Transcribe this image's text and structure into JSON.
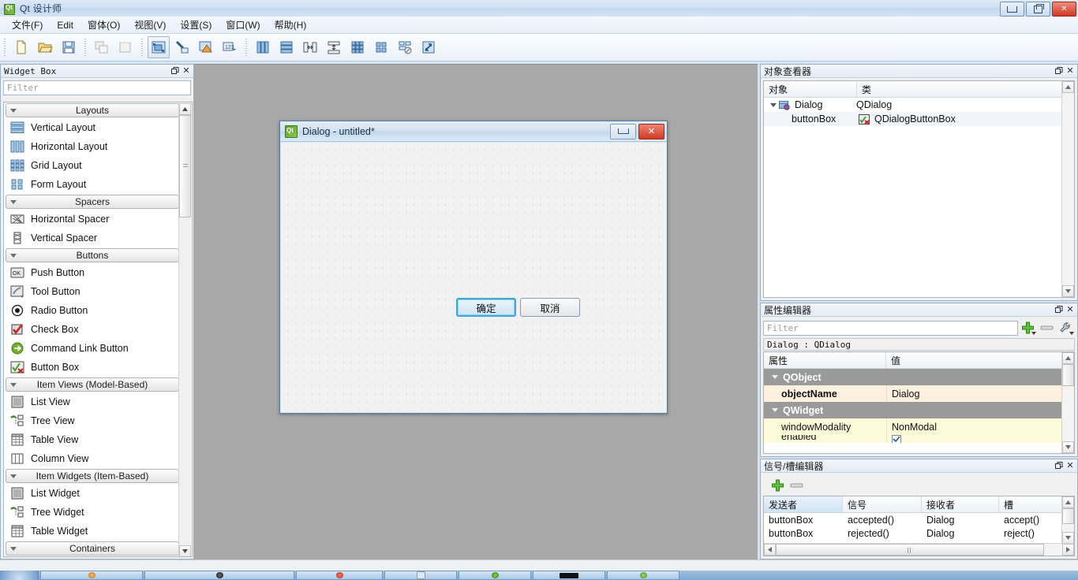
{
  "window": {
    "title": "Qt 设计师",
    "app_icon": "qt-logo-icon",
    "buttons": {
      "minimize": "minimize-icon",
      "maximize": "maximize-icon",
      "close": "close-icon"
    }
  },
  "menubar": {
    "items": [
      {
        "label": "文件(F)",
        "name": "menu-file"
      },
      {
        "label": "Edit",
        "name": "menu-edit"
      },
      {
        "label": "窗体(O)",
        "name": "menu-form"
      },
      {
        "label": "视图(V)",
        "name": "menu-view"
      },
      {
        "label": "设置(S)",
        "name": "menu-settings"
      },
      {
        "label": "窗口(W)",
        "name": "menu-window"
      },
      {
        "label": "帮助(H)",
        "name": "menu-help"
      }
    ]
  },
  "toolbar": {
    "groups": [
      {
        "buttons": [
          {
            "name": "new-form-button",
            "icon": "new-document-icon"
          },
          {
            "name": "open-form-button",
            "icon": "open-folder-icon"
          },
          {
            "name": "save-form-button",
            "icon": "save-disk-icon"
          }
        ]
      },
      {
        "buttons": [
          {
            "name": "undo-button",
            "icon": "undo-icon"
          },
          {
            "name": "redo-button",
            "icon": "redo-icon"
          }
        ]
      },
      {
        "buttons": [
          {
            "name": "edit-widgets-button",
            "icon": "edit-widgets-icon",
            "active": true
          },
          {
            "name": "edit-signals-slots-button",
            "icon": "signals-slots-icon"
          },
          {
            "name": "edit-buddies-button",
            "icon": "buddies-icon"
          },
          {
            "name": "edit-tab-order-button",
            "icon": "tab-order-icon"
          }
        ]
      },
      {
        "buttons": [
          {
            "name": "layout-horizontally-button",
            "icon": "layout-horizontal-icon"
          },
          {
            "name": "layout-vertically-button",
            "icon": "layout-vertical-icon"
          },
          {
            "name": "layout-in-splitter-horizontal-button",
            "icon": "splitter-horizontal-icon"
          },
          {
            "name": "layout-in-splitter-vertical-button",
            "icon": "splitter-vertical-icon"
          },
          {
            "name": "layout-in-grid-button",
            "icon": "layout-grid-icon"
          },
          {
            "name": "layout-in-form-button",
            "icon": "layout-form-icon"
          },
          {
            "name": "break-layout-button",
            "icon": "break-layout-icon"
          },
          {
            "name": "adjust-size-button",
            "icon": "adjust-size-icon"
          }
        ]
      }
    ]
  },
  "widget_box": {
    "title": "Widget Box",
    "filter_placeholder": "Filter",
    "titlebar_buttons": {
      "float": "float-icon",
      "close": "close-icon"
    },
    "categories": [
      {
        "name": "Layouts",
        "items": [
          {
            "label": "Vertical Layout",
            "icon": "vertical-layout-icon"
          },
          {
            "label": "Horizontal Layout",
            "icon": "horizontal-layout-icon"
          },
          {
            "label": "Grid Layout",
            "icon": "grid-layout-icon"
          },
          {
            "label": "Form Layout",
            "icon": "form-layout-icon"
          }
        ]
      },
      {
        "name": "Spacers",
        "items": [
          {
            "label": "Horizontal Spacer",
            "icon": "horizontal-spacer-icon"
          },
          {
            "label": "Vertical Spacer",
            "icon": "vertical-spacer-icon"
          }
        ]
      },
      {
        "name": "Buttons",
        "items": [
          {
            "label": "Push Button",
            "icon": "push-button-icon"
          },
          {
            "label": "Tool Button",
            "icon": "tool-button-icon"
          },
          {
            "label": "Radio Button",
            "icon": "radio-button-icon"
          },
          {
            "label": "Check Box",
            "icon": "check-box-icon"
          },
          {
            "label": "Command Link Button",
            "icon": "command-link-icon"
          },
          {
            "label": "Button Box",
            "icon": "button-box-icon"
          }
        ]
      },
      {
        "name": "Item Views (Model-Based)",
        "items": [
          {
            "label": "List View",
            "icon": "list-view-icon"
          },
          {
            "label": "Tree View",
            "icon": "tree-view-icon"
          },
          {
            "label": "Table View",
            "icon": "table-view-icon"
          },
          {
            "label": "Column View",
            "icon": "column-view-icon"
          }
        ]
      },
      {
        "name": "Item Widgets (Item-Based)",
        "items": [
          {
            "label": "List Widget",
            "icon": "list-widget-icon"
          },
          {
            "label": "Tree Widget",
            "icon": "tree-widget-icon"
          },
          {
            "label": "Table Widget",
            "icon": "table-widget-icon"
          }
        ]
      },
      {
        "name": "Containers",
        "items": []
      }
    ]
  },
  "form_window": {
    "title": "Dialog - untitled*",
    "icon": "qt-form-icon",
    "buttons": {
      "minimize": "minimize-icon",
      "close": "close-icon"
    },
    "widgets": [
      {
        "label": "确定",
        "name": "ok-button",
        "selected": true
      },
      {
        "label": "取消",
        "name": "cancel-button",
        "selected": false
      }
    ]
  },
  "object_inspector": {
    "title": "对象查看器",
    "titlebar_buttons": {
      "float": "float-icon",
      "close": "close-icon"
    },
    "columns": [
      "对象",
      "类"
    ],
    "rows": [
      {
        "object": "Dialog",
        "class": "QDialog",
        "indent": 0,
        "expandable": true,
        "icon": "qdialog-icon"
      },
      {
        "object": "buttonBox",
        "class": "QDialogButtonBox",
        "indent": 1,
        "expandable": false,
        "icon": "button-box-icon"
      }
    ]
  },
  "property_editor": {
    "title": "属性编辑器",
    "titlebar_buttons": {
      "float": "float-icon",
      "close": "close-icon"
    },
    "filter_placeholder": "Filter",
    "tools": [
      {
        "name": "add-dynamic-property-button",
        "icon": "plus-icon"
      },
      {
        "name": "remove-dynamic-property-button",
        "icon": "minus-icon"
      },
      {
        "name": "configure-property-editor-button",
        "icon": "wrench-icon"
      }
    ],
    "object_line": "Dialog : QDialog",
    "columns": [
      "属性",
      "值"
    ],
    "rows": [
      {
        "type": "group",
        "key": "QObject"
      },
      {
        "type": "prop",
        "key": "objectName",
        "value": "Dialog",
        "modified": true,
        "bg": "#fdf0df"
      },
      {
        "type": "group",
        "key": "QWidget"
      },
      {
        "type": "prop",
        "key": "windowModality",
        "value": "NonModal",
        "modified": false,
        "bg": "#fdfbd9"
      },
      {
        "type": "prop",
        "key": "enabled",
        "value": "",
        "modified": false,
        "bg": "#fdfbd9"
      }
    ]
  },
  "signal_slot_editor": {
    "title": "信号/槽编辑器",
    "titlebar_buttons": {
      "float": "float-icon",
      "close": "close-icon"
    },
    "tools": [
      {
        "name": "add-connection-button",
        "icon": "plus-icon"
      },
      {
        "name": "remove-connection-button",
        "icon": "minus-icon"
      }
    ],
    "columns": [
      "发送者",
      "信号",
      "接收者",
      "槽"
    ],
    "rows": [
      {
        "sender": "buttonBox",
        "signal": "accepted()",
        "receiver": "Dialog",
        "slot": "accept()"
      },
      {
        "sender": "buttonBox",
        "signal": "rejected()",
        "receiver": "Dialog",
        "slot": "reject()"
      }
    ]
  },
  "colors": {
    "accent": "#3ea6dd",
    "workspace_bg": "#a8a8a8",
    "panel_bg": "#f0f0f0",
    "group_row": "#9a9a9a",
    "modified_row": "#fdf0df",
    "prop_row": "#fdfbd9",
    "close_red": "#cf3a22",
    "taskbar": "#7ea8d0"
  }
}
